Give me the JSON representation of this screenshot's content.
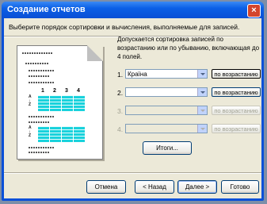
{
  "window": {
    "title": "Создание отчетов",
    "close_label": "×"
  },
  "instructions": "Выберите порядок сортировки и вычисления, выполняемые для записей.",
  "description": "Допускается сортировка записей по возрастанию или по убыванию, включающая до 4 полей.",
  "preview": {
    "column_numbers": [
      "1",
      "2",
      "3",
      "4"
    ]
  },
  "sort_rows": [
    {
      "number": "1.",
      "field": "Країна",
      "order": "по возрастанию",
      "enabled": true
    },
    {
      "number": "2.",
      "field": "",
      "order": "по возрастанию",
      "enabled": true
    },
    {
      "number": "3.",
      "field": "",
      "order": "по возрастанию",
      "enabled": false
    },
    {
      "number": "4.",
      "field": "",
      "order": "по возрастанию",
      "enabled": false
    }
  ],
  "totals_button": "Итоги...",
  "buttons": {
    "cancel": "Отмена",
    "back": "< Назад",
    "next": "Далее >",
    "finish": "Готово"
  }
}
